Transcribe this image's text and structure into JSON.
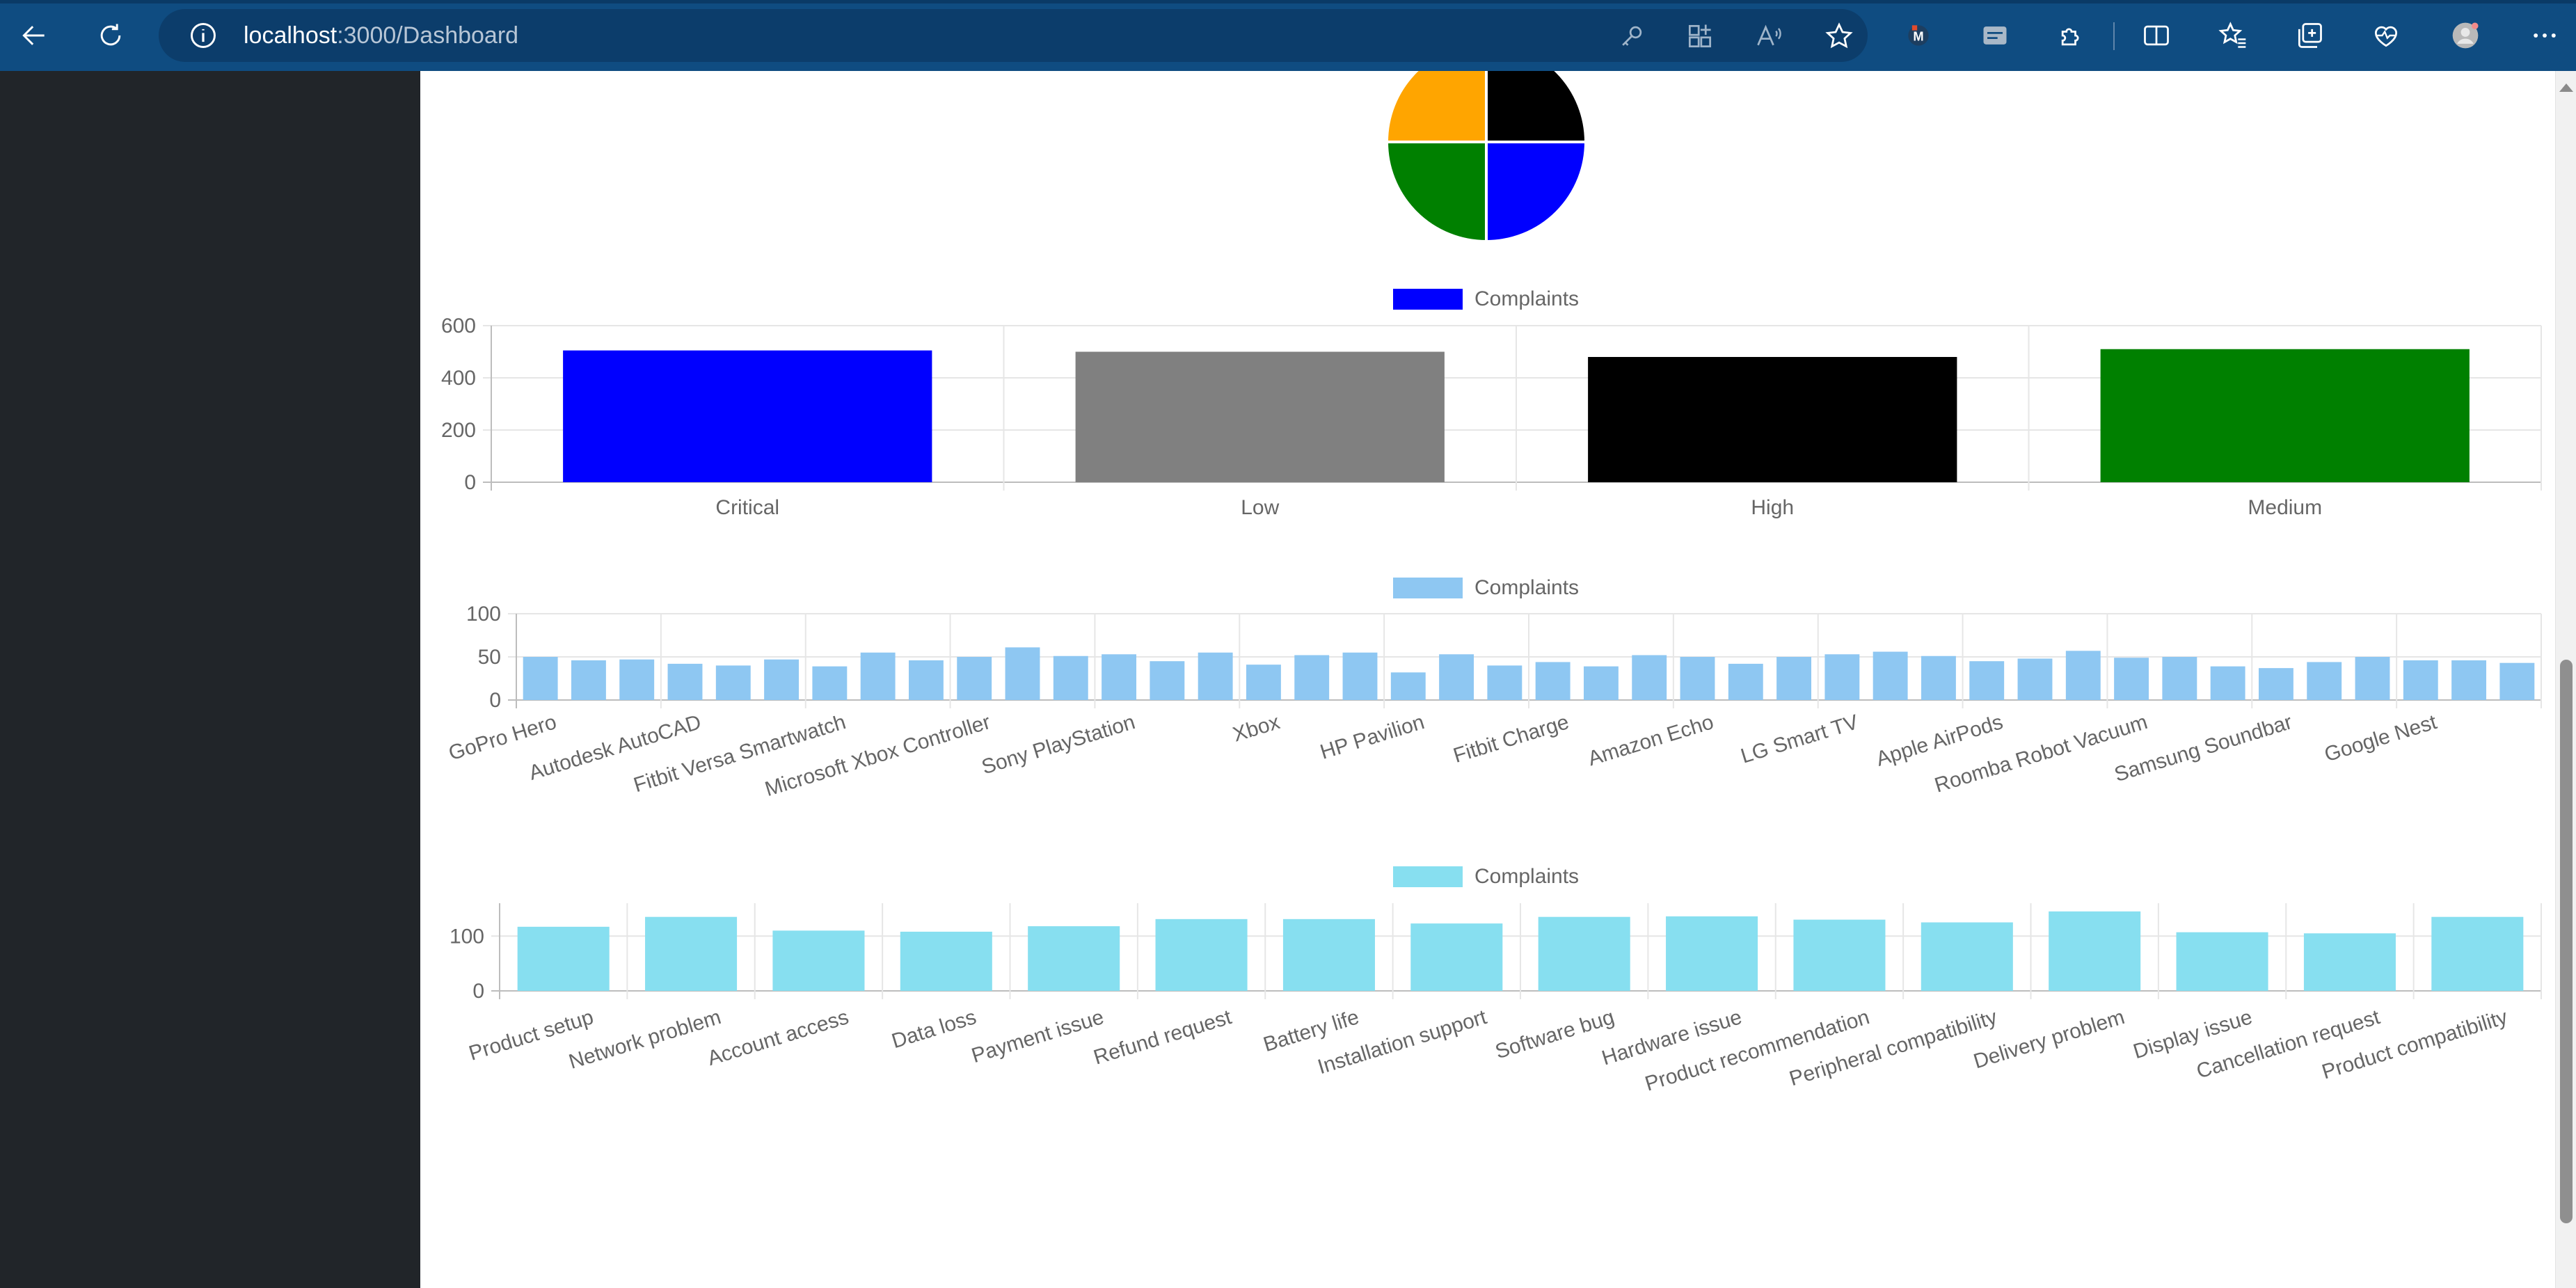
{
  "browser": {
    "url_host": "localhost",
    "url_path": ":3000/Dashboard",
    "icons": [
      "back-icon",
      "refresh-icon",
      "info-icon",
      "key-icon",
      "apps-icon",
      "read-aloud-icon",
      "favorite-star-icon",
      "extension-m-icon",
      "extension-card-icon",
      "extensions-puzzle-icon",
      "split-screen-icon",
      "favorites-icon",
      "collections-icon",
      "health-icon",
      "profile-avatar-icon",
      "more-icon"
    ]
  },
  "charts": {
    "pie": {
      "chart_data": {
        "type": "pie",
        "partial": true,
        "slices": [
          {
            "color": "#000000",
            "value": 25
          },
          {
            "color": "#0000ff",
            "value": 25
          },
          {
            "color": "#008000",
            "value": 25
          },
          {
            "color": "#ffa500",
            "value": 25
          }
        ]
      }
    },
    "priority": {
      "legend": "Complaints",
      "chart_data": {
        "type": "bar",
        "categories": [
          "Critical",
          "Low",
          "High",
          "Medium"
        ],
        "series": [
          {
            "name": "Complaints",
            "values": [
              505,
              500,
              480,
              510
            ]
          }
        ],
        "colors": [
          "#0000ff",
          "#808080",
          "#000000",
          "#008000"
        ],
        "ylim": [
          0,
          600
        ],
        "yticks": [
          0,
          200,
          400,
          600
        ]
      }
    },
    "product": {
      "legend": "Complaints",
      "color": "#8ec7f2",
      "chart_data": {
        "type": "bar",
        "categories_shown": [
          "GoPro Hero",
          "Autodesk AutoCAD",
          "Fitbit Versa Smartwatch",
          "Microsoft Xbox Controller",
          "Sony PlayStation",
          "Xbox",
          "HP Pavilion",
          "Fitbit Charge",
          "Amazon Echo",
          "LG Smart TV",
          "Apple AirPods",
          "Roomba Robot Vacuum",
          "Samsung Soundbar",
          "Google Nest"
        ],
        "series": [
          {
            "name": "Complaints",
            "values": [
              50,
              46,
              47,
              42,
              40,
              47,
              39,
              55,
              46,
              50,
              61,
              51,
              53,
              45,
              55,
              41,
              52,
              55,
              32,
              53,
              40,
              44,
              39,
              52,
              50,
              42,
              50,
              53,
              56,
              51,
              45,
              48,
              57,
              49,
              50,
              39,
              37,
              44,
              50,
              46,
              46,
              43
            ]
          }
        ],
        "ylim": [
          0,
          100
        ],
        "yticks": [
          0,
          50,
          100
        ]
      }
    },
    "issue": {
      "legend": "Complaints",
      "color": "#87dff0",
      "chart_data": {
        "type": "bar",
        "categories": [
          "Product setup",
          "Network problem",
          "Account access",
          "Data loss",
          "Payment issue",
          "Refund request",
          "Battery life",
          "Installation support",
          "Software bug",
          "Hardware issue",
          "Product recommendation",
          "Peripheral compatibility",
          "Delivery problem",
          "Display issue",
          "Cancellation request",
          "Product compatibility"
        ],
        "series": [
          {
            "name": "Complaints",
            "values": [
              117,
              135,
              110,
              108,
              118,
              131,
              131,
              123,
              135,
              136,
              130,
              125,
              145,
              107,
              105,
              135
            ]
          }
        ],
        "ylim": [
          0,
          160
        ],
        "yticks": [
          0,
          100
        ]
      }
    }
  }
}
